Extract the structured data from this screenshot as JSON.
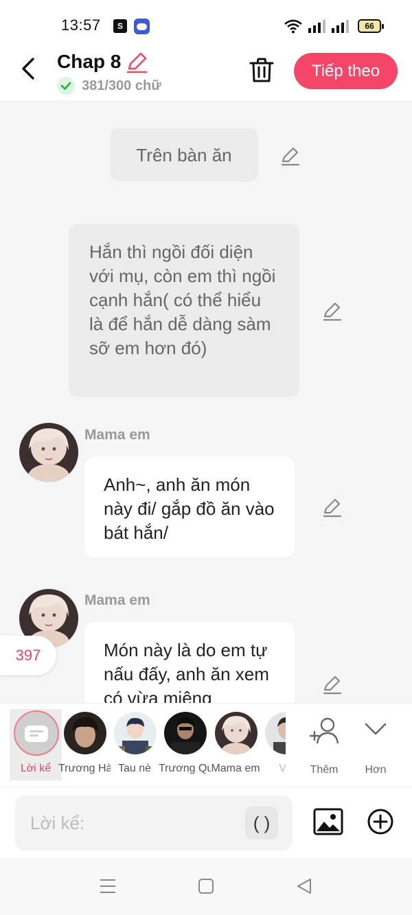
{
  "status_bar": {
    "time": "13:57",
    "battery": "66",
    "shop_icon": "S"
  },
  "header": {
    "title": "Chap 8",
    "word_count": "381/300 chữ",
    "next_label": "Tiếp theo"
  },
  "chat": {
    "messages": [
      {
        "type": "narration",
        "text": "Trên bàn ăn"
      },
      {
        "type": "narration",
        "text": "Hắn thì ngồi đối diện với mụ, còn em thì ngồi cạnh hắn( có thể hiểu là để hắn dễ dàng sàm sỡ em hơn đó)"
      },
      {
        "type": "character",
        "sender": "Mama em",
        "text": "Anh~, anh ăn món này đi/ gắp đồ ăn vào bát hắn/"
      },
      {
        "type": "character",
        "sender": "Mama em",
        "text": "Món này là do em tự nấu đấy, anh ăn xem có vừa miệng"
      }
    ],
    "counter": "397"
  },
  "characters": [
    {
      "label": "Lời kể",
      "selected": true
    },
    {
      "label": "Trương Hà"
    },
    {
      "label": "Tau nè"
    },
    {
      "label": "Trương Qu"
    },
    {
      "label": "Mama em"
    },
    {
      "label": "Vệ"
    }
  ],
  "actions": {
    "add_label": "Thêm",
    "more_label": "Hơn"
  },
  "input": {
    "placeholder": "Lời kể:",
    "paren_label": "( )"
  },
  "colors": {
    "accent": "#f5466a",
    "counter": "#e8465f",
    "bubble_gray": "#ebebeb",
    "background": "#f5f5f5"
  }
}
